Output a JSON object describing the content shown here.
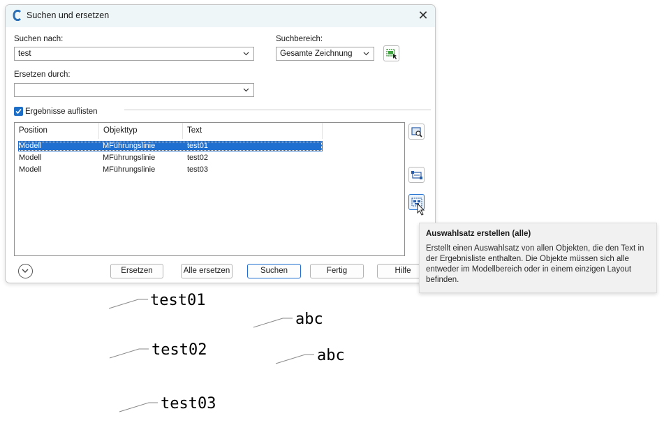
{
  "dialog": {
    "title": "Suchen und ersetzen",
    "search_label": "Suchen nach:",
    "search_value": "test",
    "scope_label": "Suchbereich:",
    "scope_value": "Gesamte Zeichnung",
    "replace_label": "Ersetzen durch:",
    "replace_value": "",
    "list_results_label": "Ergebnisse auflisten",
    "list_results_checked": true,
    "columns": [
      "Position",
      "Objekttyp",
      "Text"
    ],
    "rows": [
      {
        "position": "Modell",
        "type": "MFührungslinie",
        "text": "test01",
        "selected": true
      },
      {
        "position": "Modell",
        "type": "MFührungslinie",
        "text": "test02",
        "selected": false
      },
      {
        "position": "Modell",
        "type": "MFührungslinie",
        "text": "test03",
        "selected": false
      }
    ],
    "buttons": {
      "replace": "Ersetzen",
      "replace_all": "Alle ersetzen",
      "search": "Suchen",
      "done": "Fertig",
      "help": "Hilfe"
    }
  },
  "tooltip": {
    "title": "Auswahlsatz erstellen (alle)",
    "body": "Erstellt einen Auswahlsatz von allen Objekten, die den Text in der Ergebnisliste enthalten. Die Objekte müssen sich alle entweder im Modellbereich oder in einem einzigen Layout befinden."
  },
  "drawing": {
    "labels": [
      "test01",
      "abc",
      "test02",
      "abc",
      "test03"
    ]
  },
  "colors": {
    "accent": "#1f6fd1",
    "title_bar": "#eef6f7",
    "tooltip_bg": "#f1f1f1"
  }
}
